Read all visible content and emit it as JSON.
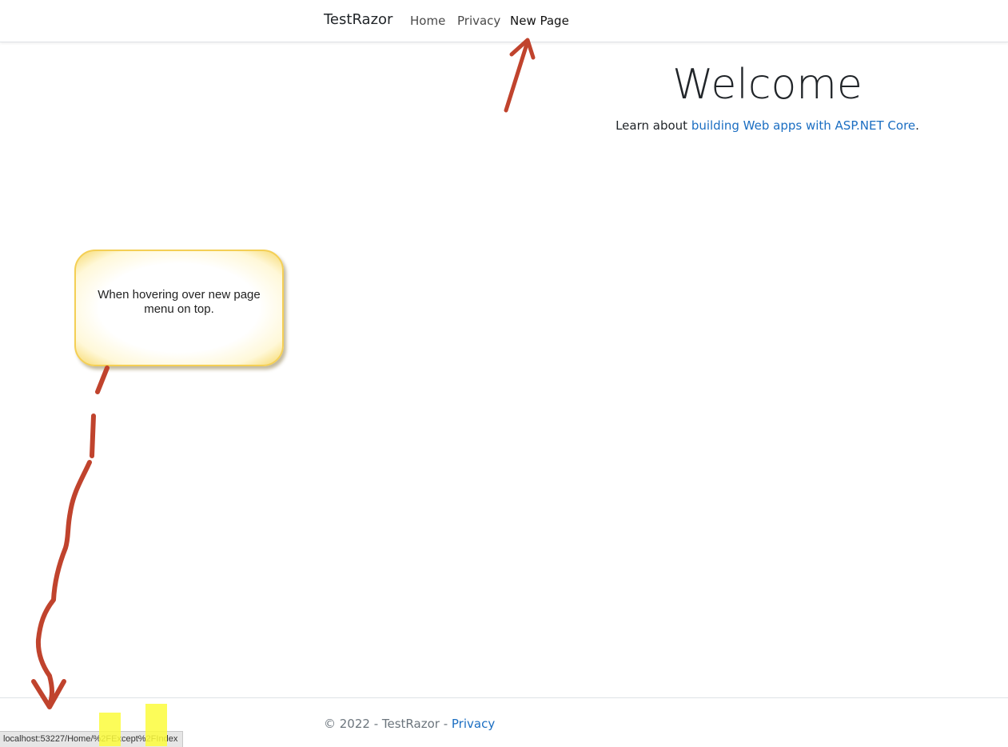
{
  "navbar": {
    "brand": "TestRazor",
    "links": [
      {
        "label": "Home"
      },
      {
        "label": "Privacy"
      },
      {
        "label": "New Page"
      }
    ]
  },
  "main": {
    "title": "Welcome",
    "lead_text": "Learn about ",
    "lead_link": "building Web apps with ASP.NET Core",
    "lead_suffix": "."
  },
  "annotation": {
    "callout_text": "When hovering over new page menu on top.",
    "color": "#c0432d",
    "highlight_color": "#fbfb3c"
  },
  "footer": {
    "copyright": "© 2022 - TestRazor - ",
    "privacy_link": "Privacy"
  },
  "status_bar": {
    "url_part1": "localhost:53227/Home/",
    "url_part2": "%2F",
    "url_part3": "Except",
    "url_part4": "%2F",
    "url_part5": "Index"
  },
  "colors": {
    "link": "#1b6ec2",
    "text": "#212529",
    "muted": "#6c757d"
  }
}
